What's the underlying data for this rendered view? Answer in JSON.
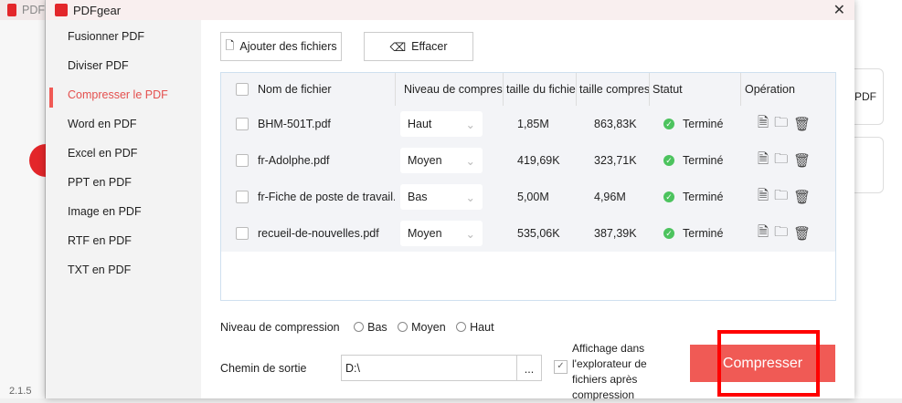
{
  "background": {
    "title": "PDF",
    "version": "2.1.5",
    "card_text": "PDF"
  },
  "window": {
    "title": "PDFgear",
    "close_icon": "close-icon"
  },
  "sidebar": {
    "items": [
      {
        "label": "Fusionner PDF"
      },
      {
        "label": "Diviser PDF"
      },
      {
        "label": "Compresser le PDF",
        "active": true
      },
      {
        "label": "Word en PDF"
      },
      {
        "label": "Excel en PDF"
      },
      {
        "label": "PPT en PDF"
      },
      {
        "label": "Image en PDF"
      },
      {
        "label": "RTF en PDF"
      },
      {
        "label": "TXT en PDF"
      }
    ]
  },
  "toolbar": {
    "add_label": "Ajouter des fichiers",
    "clear_label": "Effacer"
  },
  "table": {
    "headers": [
      "Nom de fichier",
      "Niveau de compress",
      "taille du fichie",
      "taille compres",
      "Statut",
      "Opération"
    ],
    "rows": [
      {
        "name": "BHM-501T.pdf",
        "level": "Haut",
        "size": "1,85M",
        "compressed": "863,83K",
        "status": "Terminé"
      },
      {
        "name": "fr-Adolphe.pdf",
        "level": "Moyen",
        "size": "419,69K",
        "compressed": "323,71K",
        "status": "Terminé"
      },
      {
        "name": "fr-Fiche de poste de travail.",
        "level": "Bas",
        "size": "5,00M",
        "compressed": "4,96M",
        "status": "Terminé"
      },
      {
        "name": "recueil-de-nouvelles.pdf",
        "level": "Moyen",
        "size": "535,06K",
        "compressed": "387,39K",
        "status": "Terminé"
      }
    ]
  },
  "options": {
    "level_label": "Niveau de compression",
    "levels": [
      "Bas",
      "Moyen",
      "Haut"
    ],
    "output_label": "Chemin de sortie",
    "output_value": "D:\\",
    "browse_label": "...",
    "show_in_explorer": "Affichage dans l'explorateur de fichiers après compression",
    "show_in_explorer_checked": true
  },
  "actions": {
    "compress_label": "Compresser"
  },
  "colors": {
    "accent": "#f05a55",
    "highlight": "#ff0000"
  }
}
